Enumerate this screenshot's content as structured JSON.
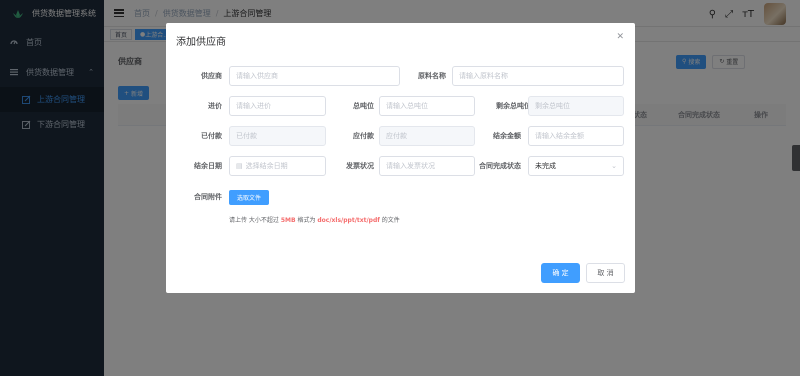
{
  "app": {
    "title": "供货数据管理系统"
  },
  "sidebar": {
    "items": [
      {
        "label": "首页",
        "icon": "dashboard-icon"
      },
      {
        "label": "供货数据管理",
        "icon": "menu-icon",
        "expanded": true
      },
      {
        "label": "上游合同管理",
        "icon": "edit-icon",
        "active": true
      },
      {
        "label": "下游合同管理",
        "icon": "edit-icon"
      }
    ]
  },
  "breadcrumb": [
    "首页",
    "供货数据管理",
    "上游合同管理"
  ],
  "tags": [
    {
      "label": "首页",
      "active": false
    },
    {
      "label": "上游合...",
      "active": true
    }
  ],
  "page": {
    "search_label": "供应商",
    "search_button": "搜索",
    "reset_button": "重置",
    "add_button": "新增",
    "table_headers": [
      "...账状态",
      "合同完成状态",
      "操作"
    ]
  },
  "dialog": {
    "title": "添加供应商",
    "fields": {
      "supplier": {
        "label": "供应商",
        "placeholder": "请输入供应商"
      },
      "material": {
        "label": "原料名称",
        "placeholder": "请输入原料名称"
      },
      "price": {
        "label": "进价",
        "placeholder": "请输入进价"
      },
      "total_ton": {
        "label": "总吨位",
        "placeholder": "请输入总吨位"
      },
      "remain_ton": {
        "label": "剩余总吨位",
        "placeholder": "剩余总吨位"
      },
      "paid": {
        "label": "已付款",
        "placeholder": "已付款"
      },
      "payable": {
        "label": "应付款",
        "placeholder": "应付款"
      },
      "balance": {
        "label": "结余金额",
        "placeholder": "请输入结余金额"
      },
      "settle_date": {
        "label": "结余日期",
        "placeholder": "选择结余日期"
      },
      "invoice": {
        "label": "发票状况",
        "placeholder": "请输入发票状况"
      },
      "complete": {
        "label": "合同完成状态",
        "value": "未完成"
      },
      "attachment": {
        "label": "合同附件",
        "button": "选取文件"
      }
    },
    "upload_tip": {
      "prefix": "请上传 大小不超过 ",
      "size": "5MB",
      "middle": " 格式为 ",
      "formats": "doc/xls/ppt/txt/pdf",
      "suffix": " 的文件"
    },
    "confirm": "确 定",
    "cancel": "取 消"
  }
}
